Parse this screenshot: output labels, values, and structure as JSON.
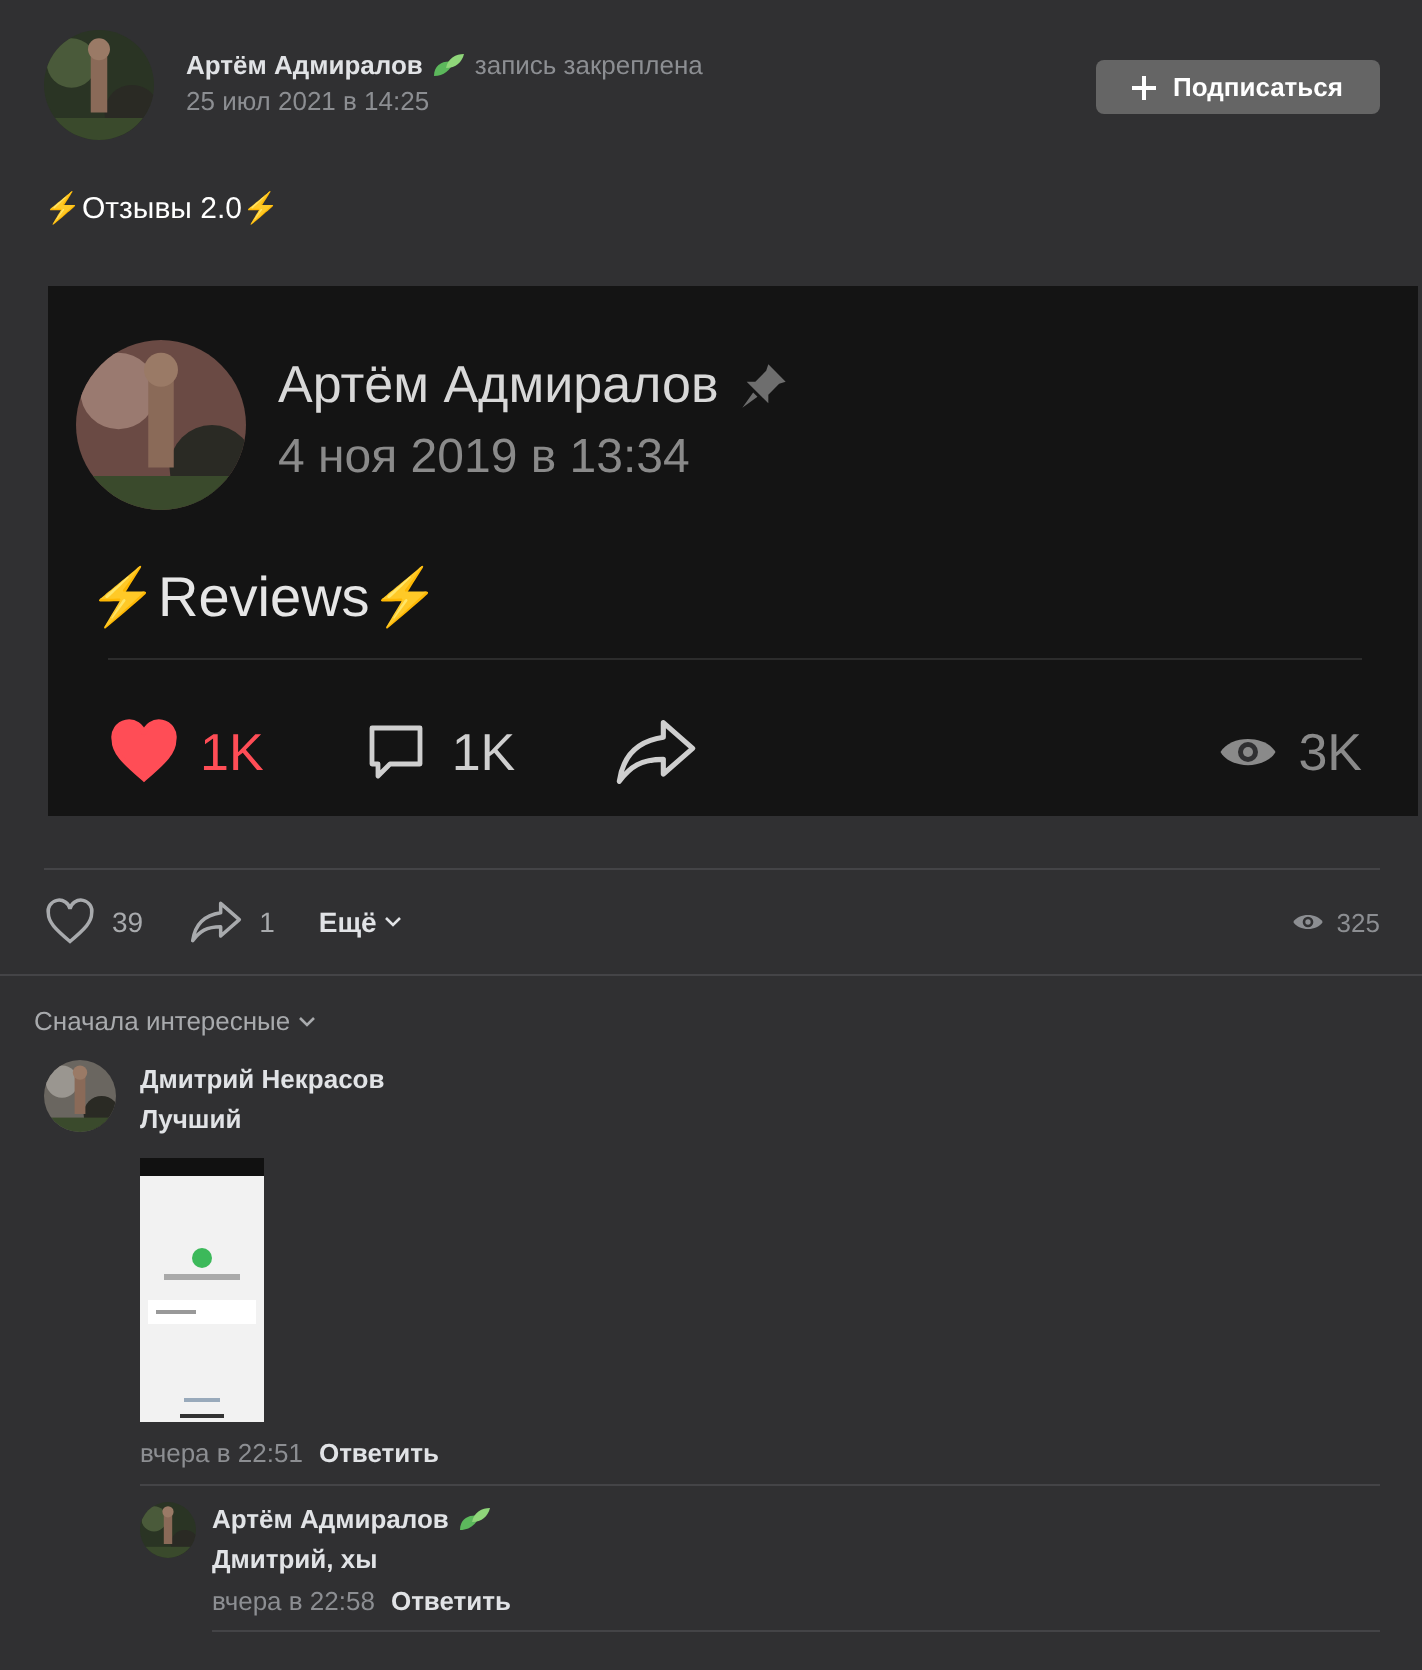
{
  "post": {
    "author": "Артём Адмиралов",
    "pinned_note": "запись закреплена",
    "date": "25 июл 2021 в 14:25",
    "subscribe_button": "Подписаться",
    "text": "⚡Отзывы 2.0⚡",
    "embedded_post": {
      "author": "Артём Адмиралов",
      "date": "4 ноя 2019 в 13:34",
      "text": "⚡Reviews⚡",
      "likes": {
        "count": "1K",
        "liked": true
      },
      "comments": "1K",
      "views": "3K"
    },
    "likes": {
      "count": "39",
      "liked": false
    },
    "shares": "1",
    "more": "Ещё",
    "views": "325"
  },
  "comments_sort": "Сначала интересные",
  "comments": [
    {
      "author": "Дмитрий Некрасов",
      "text": "Лучший",
      "time": "вчера в 22:51",
      "reply": "Ответить",
      "replies": [
        {
          "author": "Артём Адмиралов",
          "text": "Дмитрий, хы",
          "time": "вчера в 22:58",
          "reply": "Ответить"
        }
      ]
    }
  ]
}
